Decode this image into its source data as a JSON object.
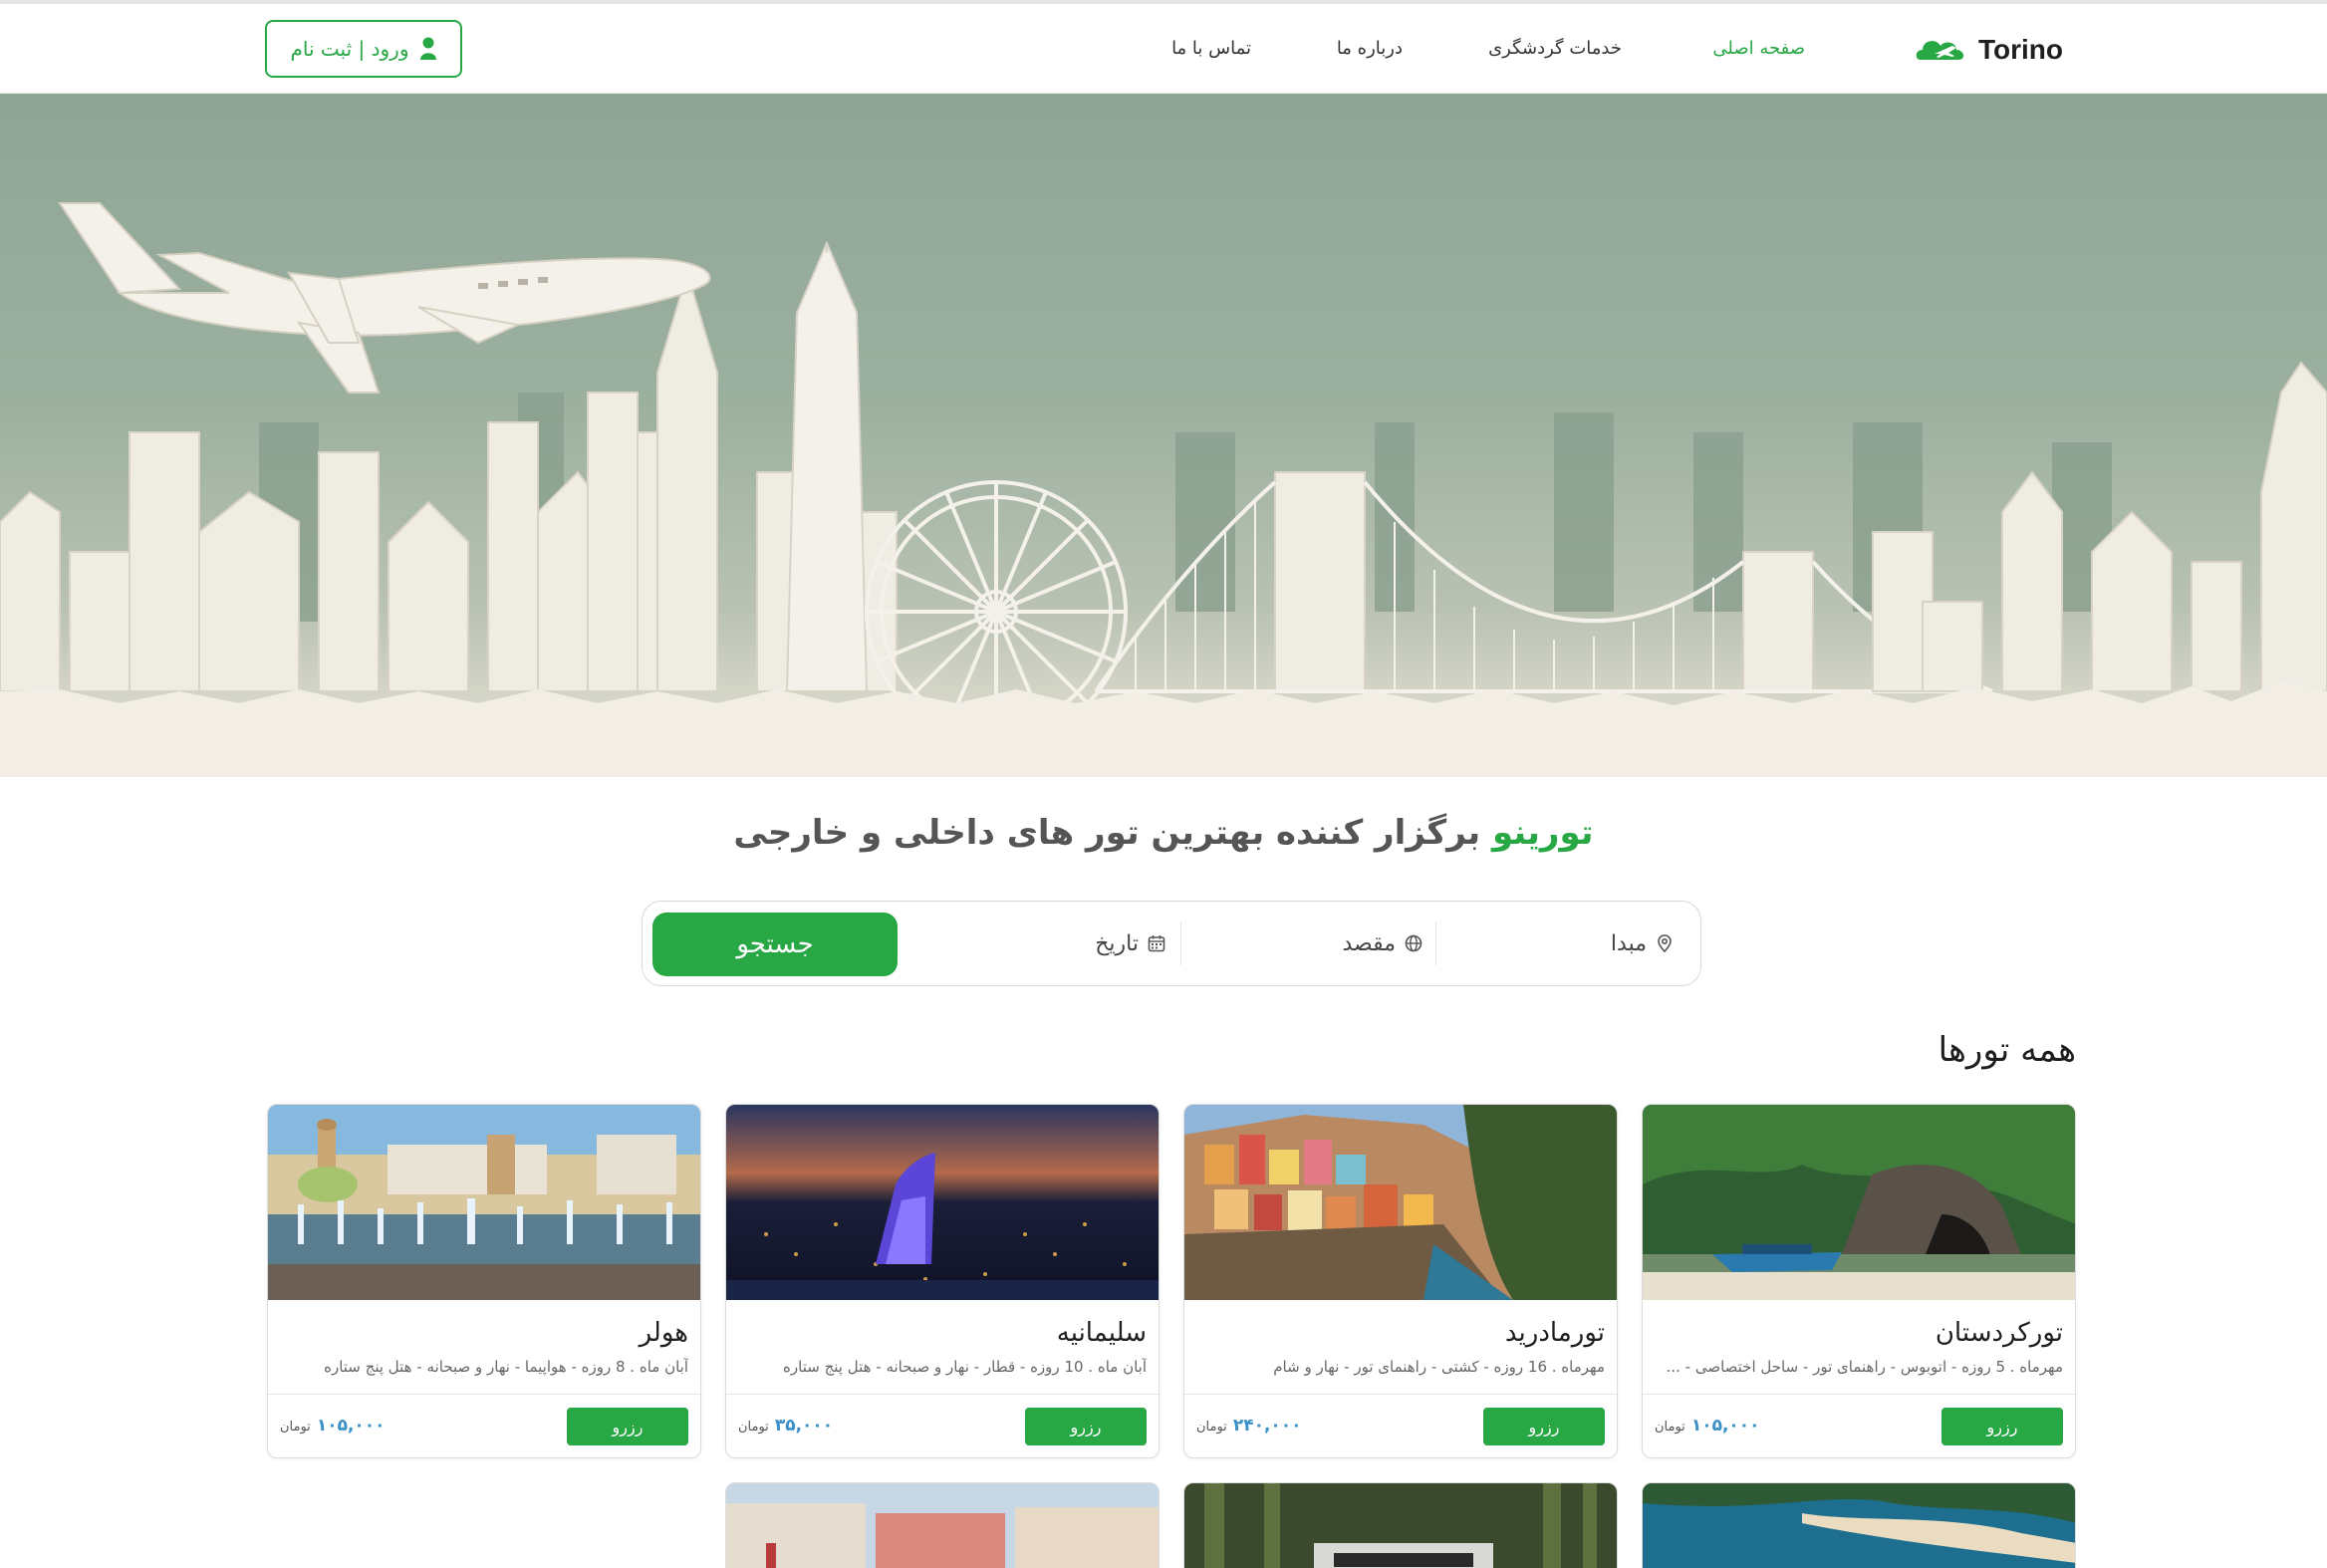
{
  "header": {
    "logo_text": "Torino",
    "nav": [
      {
        "label": "صفحه اصلی",
        "active": true
      },
      {
        "label": "خدمات گردشگری",
        "active": false
      },
      {
        "label": "درباره ما",
        "active": false
      },
      {
        "label": "تماس با ما",
        "active": false
      }
    ],
    "auth_label": "ورود | ثبت نام"
  },
  "headline": {
    "brand": "تورینو",
    "rest": " برگزار کننده بهترین تور های داخلی و خارجی"
  },
  "search": {
    "origin": "مبدا",
    "destination": "مقصد",
    "date": "تاریخ",
    "button": "جستجو"
  },
  "section_title": "همه تورها",
  "reserve_label": "رزرو",
  "currency": "تومان",
  "tours": [
    {
      "title": "تورکردستان",
      "desc": "مهرماه . 5 روزه - اتوبوس - راهنمای تور - ساحل اختصاصی - ...",
      "price": "۱۰۵,۰۰۰"
    },
    {
      "title": "تورمادرید",
      "desc": "مهرماه . 16 روزه - کشتی - راهنمای تور - نهار و شام",
      "price": "۲۴۰,۰۰۰"
    },
    {
      "title": "سلیمانیه",
      "desc": "آبان ماه . 10 روزه - قطار - نهار و صبحانه - هتل پنج ستاره",
      "price": "۳۵,۰۰۰"
    },
    {
      "title": "هولر",
      "desc": "آبان ماه . 8 روزه - هواپیما - نهار و صبحانه - هتل پنج ستاره",
      "price": "۱۰۵,۰۰۰"
    }
  ],
  "colors": {
    "accent": "#28a745",
    "price": "#3a8fc7"
  }
}
